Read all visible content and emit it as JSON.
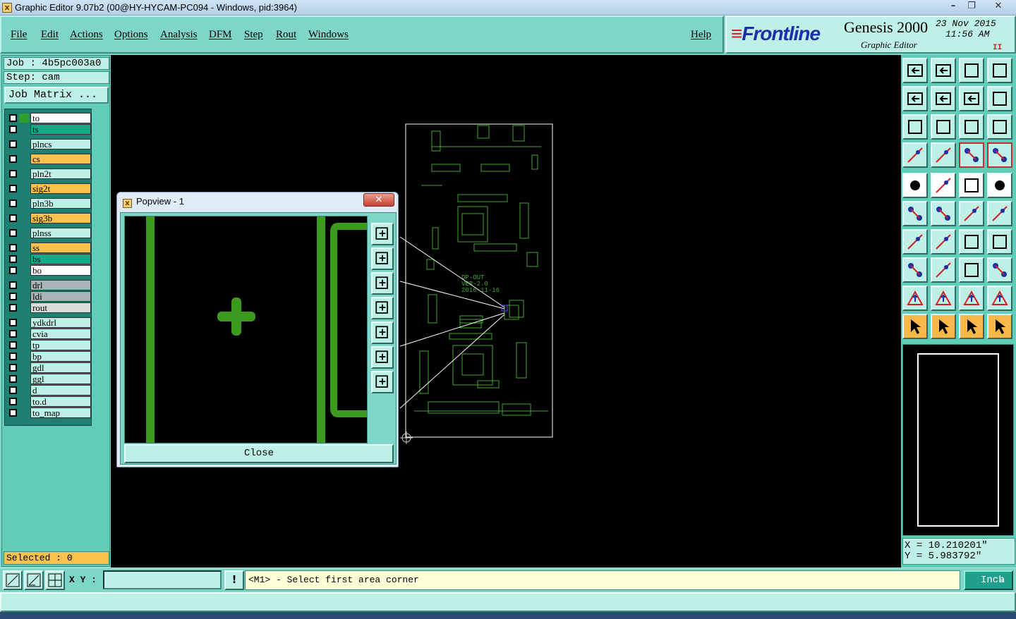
{
  "window": {
    "title": "Graphic Editor 9.07b2 (00@HY-HYCAM-PC094 - Windows, pid:3964)",
    "minimize": "–",
    "restore": "❐",
    "close": "✕"
  },
  "menu": {
    "file": "File",
    "edit": "Edit",
    "actions": "Actions",
    "options": "Options",
    "analysis": "Analysis",
    "dfm": "DFM",
    "step": "Step",
    "rout": "Rout",
    "windows": "Windows",
    "help": "Help"
  },
  "brand": {
    "logo": "Frontline",
    "product": "Genesis 2000",
    "subtitle": "Graphic Editor",
    "date": "23 Nov 2015",
    "time": "11:56 AM",
    "pause": "II"
  },
  "left": {
    "job": "Job : 4b5pc003a0",
    "step": "Step: cam",
    "job_matrix": "Job Matrix ...",
    "selected": "Selected : 0"
  },
  "layers": [
    {
      "name": "to",
      "color": "#ffffff",
      "swatch": "#2e9e2e"
    },
    {
      "name": "ts",
      "color": "#1aa88a",
      "swatch": ""
    },
    {
      "name": "plncs",
      "color": "#bff0e8",
      "swatch": ""
    },
    {
      "name": "cs",
      "color": "#f8c24c",
      "swatch": ""
    },
    {
      "name": "pln2t",
      "color": "#bff0e8",
      "swatch": ""
    },
    {
      "name": "sig2t",
      "color": "#f8c24c",
      "swatch": ""
    },
    {
      "name": "pln3b",
      "color": "#bff0e8",
      "swatch": ""
    },
    {
      "name": "sig3b",
      "color": "#f8c24c",
      "swatch": ""
    },
    {
      "name": "plnss",
      "color": "#bff0e8",
      "swatch": ""
    },
    {
      "name": "ss",
      "color": "#f8c24c",
      "swatch": ""
    },
    {
      "name": "bs",
      "color": "#1aa88a",
      "swatch": ""
    },
    {
      "name": "bo",
      "color": "#ffffff",
      "swatch": ""
    },
    {
      "name": "drl",
      "color": "#aab4b8",
      "swatch": ""
    },
    {
      "name": "ldi",
      "color": "#aab4b8",
      "swatch": ""
    },
    {
      "name": "rout",
      "color": "#d8dcdc",
      "swatch": ""
    },
    {
      "name": "ydkdrl",
      "color": "#bff0e8",
      "swatch": ""
    },
    {
      "name": "cvia",
      "color": "#bff0e8",
      "swatch": ""
    },
    {
      "name": "tp",
      "color": "#bff0e8",
      "swatch": ""
    },
    {
      "name": "bp",
      "color": "#bff0e8",
      "swatch": ""
    },
    {
      "name": "gdl",
      "color": "#bff0e8",
      "swatch": ""
    },
    {
      "name": "ggl",
      "color": "#bff0e8",
      "swatch": ""
    },
    {
      "name": "d",
      "color": "#bff0e8",
      "swatch": ""
    },
    {
      "name": "to.d",
      "color": "#bff0e8",
      "swatch": ""
    },
    {
      "name": "to_map",
      "color": "#bff0e8",
      "swatch": ""
    }
  ],
  "board": {
    "text1": "DP-OUT",
    "text2": "VER-2.0",
    "text3": "2016-11-16"
  },
  "popview": {
    "title": "Popview - 1",
    "close_button": "Close",
    "close_x": "✕"
  },
  "coords": {
    "x": "X = 10.210201\"",
    "y": "Y = 5.983792\""
  },
  "status": {
    "xy_label": "X Y :",
    "xy_value": "",
    "alert": "!",
    "message": "<M1> - Select first area corner",
    "unit": "Inch",
    "unit_menu": "≡"
  },
  "tool_icons": [
    "zoom-home-icon",
    "zoom-fit-icon",
    "home-icon",
    "split-view-icon",
    "pan-left-icon",
    "pan-right-icon",
    "undo-zoom-icon",
    "redo-zoom-icon",
    "fit-all-icon",
    "fit-profile-icon",
    "one-to-one-icon",
    "help-icon",
    "snap-tool-icon",
    "probe-icon",
    "net-highlight-icon",
    "net-select-icon",
    "pad-icon",
    "line-icon",
    "ruler-icon",
    "dot-icon",
    "node-icon",
    "cross-icon",
    "segment-icon",
    "arc-icon",
    "angle-icon",
    "slash-icon",
    "rotate-icon",
    "mirror-icon",
    "move-icon",
    "cut-icon",
    "distance-icon",
    "component-icon",
    "triangle-icon",
    "triangle-up-icon",
    "triangle-filled-icon",
    "triangle-cut-icon",
    "select-arrow-icon",
    "select-box-icon",
    "select-circle-icon",
    "select-multi-icon"
  ],
  "colors": {
    "panel": "#7fd6c8",
    "board_lines": "#3faa2e",
    "highlight": "#f8c24c"
  }
}
